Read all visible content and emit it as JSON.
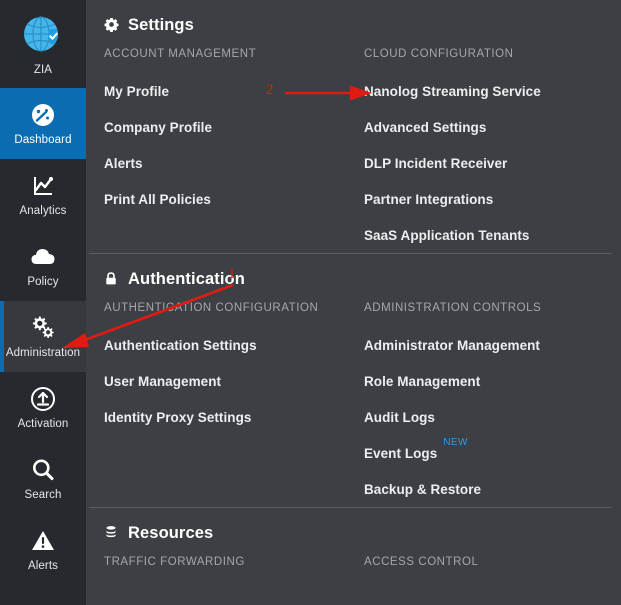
{
  "theme": {
    "sidebar_bg": "#26292d",
    "main_bg": "#3c3f43",
    "accent_blue": "#0b6cb1",
    "badge_blue": "#2f9bea",
    "annotation_red": "#e01b12",
    "divider": "#5a5d61",
    "text_primary": "#eceef0",
    "text_muted": "#a4a7ab"
  },
  "sidebar": {
    "brand": {
      "label": "ZIA",
      "icon": "globe-shield-icon"
    },
    "items": [
      {
        "label": "Dashboard",
        "icon": "gauge-icon",
        "state": "active-blue"
      },
      {
        "label": "Analytics",
        "icon": "chart-line-icon",
        "state": "normal"
      },
      {
        "label": "Policy",
        "icon": "cloud-icon",
        "state": "normal"
      },
      {
        "label": "Administration",
        "icon": "gears-icon",
        "state": "active-dark"
      },
      {
        "label": "Activation",
        "icon": "upload-circle-icon",
        "state": "normal"
      },
      {
        "label": "Search",
        "icon": "magnifier-icon",
        "state": "normal"
      },
      {
        "label": "Alerts",
        "icon": "warning-triangle-icon",
        "state": "normal"
      }
    ]
  },
  "sections": [
    {
      "title": "Settings",
      "icon": "gear-icon",
      "has_top_divider": false,
      "columns": [
        {
          "label": "ACCOUNT MANAGEMENT",
          "links": [
            {
              "text": "My Profile"
            },
            {
              "text": "Company Profile"
            },
            {
              "text": "Alerts"
            },
            {
              "text": "Print All Policies"
            }
          ]
        },
        {
          "label": "CLOUD CONFIGURATION",
          "links": [
            {
              "text": "Nanolog Streaming Service"
            },
            {
              "text": "Advanced Settings"
            },
            {
              "text": "DLP Incident Receiver"
            },
            {
              "text": "Partner Integrations"
            },
            {
              "text": "SaaS Application Tenants"
            }
          ]
        }
      ]
    },
    {
      "title": "Authentication",
      "icon": "lock-icon",
      "has_top_divider": true,
      "columns": [
        {
          "label": "AUTHENTICATION CONFIGURATION",
          "links": [
            {
              "text": "Authentication Settings"
            },
            {
              "text": "User Management"
            },
            {
              "text": "Identity Proxy Settings"
            }
          ]
        },
        {
          "label": "ADMINISTRATION CONTROLS",
          "links": [
            {
              "text": "Administrator Management"
            },
            {
              "text": "Role Management"
            },
            {
              "text": "Audit Logs"
            },
            {
              "text": "Event Logs",
              "badge": "NEW"
            },
            {
              "text": "Backup & Restore"
            }
          ]
        }
      ]
    },
    {
      "title": "Resources",
      "icon": "database-icon",
      "has_top_divider": true,
      "columns": [
        {
          "label": "TRAFFIC FORWARDING",
          "links": []
        },
        {
          "label": "ACCESS CONTROL",
          "links": []
        }
      ]
    }
  ],
  "annotations": [
    {
      "number": "2",
      "target": "Nanolog Streaming Service"
    },
    {
      "number": "1",
      "target": "Administration"
    }
  ]
}
